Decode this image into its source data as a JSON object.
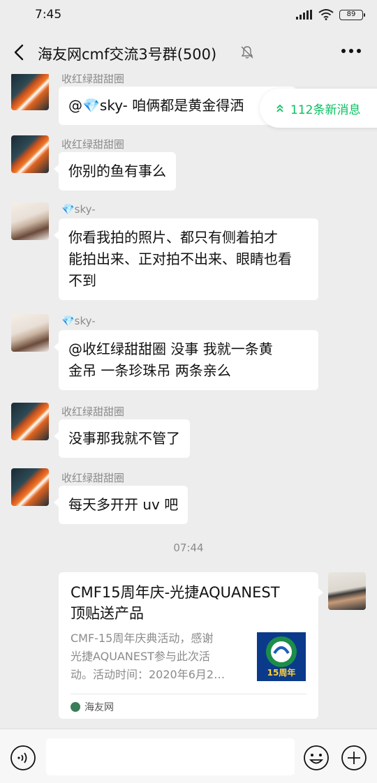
{
  "status_bar": {
    "time": "7:45",
    "battery": "89"
  },
  "header": {
    "title": "海友网cmf交流3号群(500)"
  },
  "new_messages": {
    "label": "112条新消息"
  },
  "messages": [
    {
      "sender": "收红绿甜甜圈",
      "text": "@💎sky- 咱俩都是黄金得洒"
    },
    {
      "sender": "收红绿甜甜圈",
      "text": "你别的鱼有事么"
    },
    {
      "sender": "💎sky-",
      "lines": [
        "你看我拍的照片、都只有侧着拍才",
        "能拍出来、正对拍不出来、眼睛也看",
        "不到"
      ]
    },
    {
      "sender": "💎sky-",
      "lines": [
        "@收红绿甜甜圈  没事 我就一条黄",
        "金吊 一条珍珠吊 两条亲么"
      ]
    },
    {
      "sender": "收红绿甜甜圈",
      "text": "没事那我就不管了"
    },
    {
      "sender": "收红绿甜甜圈",
      "text": "每天多开开 uv 吧"
    }
  ],
  "timestamp": "07:44",
  "link_card": {
    "title_lines": [
      "CMF15周年庆-光捷AQUANEST",
      "顶贴送产品"
    ],
    "desc_lines": [
      "CMF-15周年庆典活动，感谢",
      "光捷AQUANEST参与此次活",
      "动。活动时间：2020年6月2…"
    ],
    "thumb_text": "15周年",
    "source": "海友网"
  },
  "colors": {
    "accent": "#07c160",
    "background": "#ededed"
  }
}
